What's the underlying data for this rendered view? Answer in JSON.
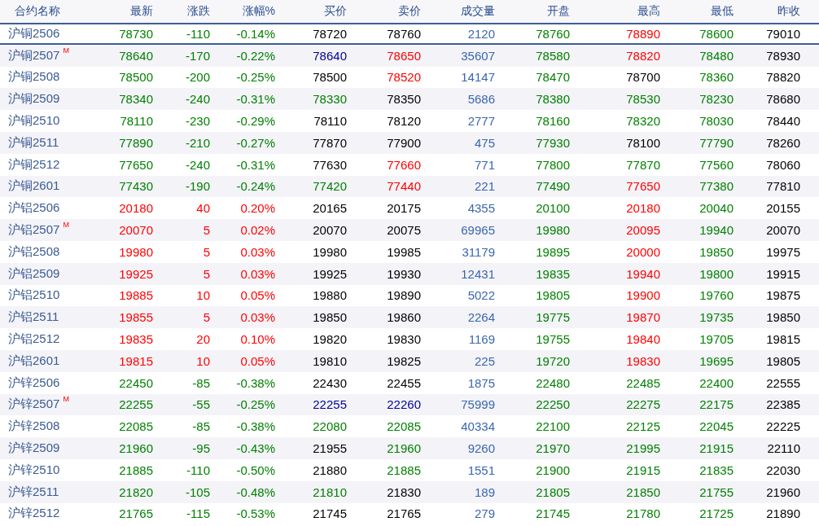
{
  "table": {
    "columns": [
      "合约名称",
      "最新",
      "涨跌",
      "涨幅%",
      "买价",
      "卖价",
      "成交量",
      "开盘",
      "最高",
      "最低",
      "昨收"
    ],
    "rows": [
      {
        "selected": true,
        "cells": [
          {
            "text": "沪铜2506"
          },
          {
            "text": "78730",
            "color": "#008000"
          },
          {
            "text": "-110",
            "color": "#008000"
          },
          {
            "text": "-0.14%",
            "color": "#008000"
          },
          {
            "text": "78720",
            "color": "#000000"
          },
          {
            "text": "78760",
            "color": "#000000"
          },
          {
            "text": "2120",
            "color": "#3a66b0"
          },
          {
            "text": "78760",
            "color": "#008000"
          },
          {
            "text": "78890",
            "color": "#ff0000"
          },
          {
            "text": "78600",
            "color": "#008000"
          },
          {
            "text": "79010",
            "color": "#000000"
          }
        ]
      },
      {
        "selected": false,
        "cells": [
          {
            "text": "沪铜2507",
            "badge": "M"
          },
          {
            "text": "78640",
            "color": "#008000"
          },
          {
            "text": "-170",
            "color": "#008000"
          },
          {
            "text": "-0.22%",
            "color": "#008000"
          },
          {
            "text": "78640",
            "color": "#000099"
          },
          {
            "text": "78650",
            "color": "#ff0000"
          },
          {
            "text": "35607",
            "color": "#3a66b0"
          },
          {
            "text": "78580",
            "color": "#008000"
          },
          {
            "text": "78820",
            "color": "#ff0000"
          },
          {
            "text": "78480",
            "color": "#008000"
          },
          {
            "text": "78930",
            "color": "#000000"
          }
        ]
      },
      {
        "selected": false,
        "cells": [
          {
            "text": "沪铜2508"
          },
          {
            "text": "78500",
            "color": "#008000"
          },
          {
            "text": "-200",
            "color": "#008000"
          },
          {
            "text": "-0.25%",
            "color": "#008000"
          },
          {
            "text": "78500",
            "color": "#000000"
          },
          {
            "text": "78520",
            "color": "#ff0000"
          },
          {
            "text": "14147",
            "color": "#3a66b0"
          },
          {
            "text": "78470",
            "color": "#008000"
          },
          {
            "text": "78700",
            "color": "#000000"
          },
          {
            "text": "78360",
            "color": "#008000"
          },
          {
            "text": "78820",
            "color": "#000000"
          }
        ]
      },
      {
        "selected": false,
        "cells": [
          {
            "text": "沪铜2509"
          },
          {
            "text": "78340",
            "color": "#008000"
          },
          {
            "text": "-240",
            "color": "#008000"
          },
          {
            "text": "-0.31%",
            "color": "#008000"
          },
          {
            "text": "78330",
            "color": "#008000"
          },
          {
            "text": "78350",
            "color": "#000000"
          },
          {
            "text": "5686",
            "color": "#3a66b0"
          },
          {
            "text": "78380",
            "color": "#008000"
          },
          {
            "text": "78530",
            "color": "#008000"
          },
          {
            "text": "78230",
            "color": "#008000"
          },
          {
            "text": "78680",
            "color": "#000000"
          }
        ]
      },
      {
        "selected": false,
        "cells": [
          {
            "text": "沪铜2510"
          },
          {
            "text": "78110",
            "color": "#008000"
          },
          {
            "text": "-230",
            "color": "#008000"
          },
          {
            "text": "-0.29%",
            "color": "#008000"
          },
          {
            "text": "78110",
            "color": "#000000"
          },
          {
            "text": "78120",
            "color": "#000000"
          },
          {
            "text": "2777",
            "color": "#3a66b0"
          },
          {
            "text": "78160",
            "color": "#008000"
          },
          {
            "text": "78320",
            "color": "#008000"
          },
          {
            "text": "78030",
            "color": "#008000"
          },
          {
            "text": "78440",
            "color": "#000000"
          }
        ]
      },
      {
        "selected": false,
        "cells": [
          {
            "text": "沪铜2511"
          },
          {
            "text": "77890",
            "color": "#008000"
          },
          {
            "text": "-210",
            "color": "#008000"
          },
          {
            "text": "-0.27%",
            "color": "#008000"
          },
          {
            "text": "77870",
            "color": "#000000"
          },
          {
            "text": "77900",
            "color": "#000000"
          },
          {
            "text": "475",
            "color": "#3a66b0"
          },
          {
            "text": "77930",
            "color": "#008000"
          },
          {
            "text": "78100",
            "color": "#000000"
          },
          {
            "text": "77790",
            "color": "#008000"
          },
          {
            "text": "78260",
            "color": "#000000"
          }
        ]
      },
      {
        "selected": false,
        "cells": [
          {
            "text": "沪铜2512"
          },
          {
            "text": "77650",
            "color": "#008000"
          },
          {
            "text": "-240",
            "color": "#008000"
          },
          {
            "text": "-0.31%",
            "color": "#008000"
          },
          {
            "text": "77630",
            "color": "#000000"
          },
          {
            "text": "77660",
            "color": "#ff0000"
          },
          {
            "text": "771",
            "color": "#3a66b0"
          },
          {
            "text": "77800",
            "color": "#008000"
          },
          {
            "text": "77870",
            "color": "#008000"
          },
          {
            "text": "77560",
            "color": "#008000"
          },
          {
            "text": "78060",
            "color": "#000000"
          }
        ]
      },
      {
        "selected": false,
        "cells": [
          {
            "text": "沪铜2601"
          },
          {
            "text": "77430",
            "color": "#008000"
          },
          {
            "text": "-190",
            "color": "#008000"
          },
          {
            "text": "-0.24%",
            "color": "#008000"
          },
          {
            "text": "77420",
            "color": "#008000"
          },
          {
            "text": "77440",
            "color": "#ff0000"
          },
          {
            "text": "221",
            "color": "#3a66b0"
          },
          {
            "text": "77490",
            "color": "#008000"
          },
          {
            "text": "77650",
            "color": "#ff0000"
          },
          {
            "text": "77380",
            "color": "#008000"
          },
          {
            "text": "77810",
            "color": "#000000"
          }
        ]
      },
      {
        "selected": false,
        "cells": [
          {
            "text": "沪铝2506"
          },
          {
            "text": "20180",
            "color": "#ff0000"
          },
          {
            "text": "40",
            "color": "#ff0000"
          },
          {
            "text": "0.20%",
            "color": "#ff0000"
          },
          {
            "text": "20165",
            "color": "#000000"
          },
          {
            "text": "20175",
            "color": "#000000"
          },
          {
            "text": "4355",
            "color": "#3a66b0"
          },
          {
            "text": "20100",
            "color": "#008000"
          },
          {
            "text": "20180",
            "color": "#ff0000"
          },
          {
            "text": "20040",
            "color": "#008000"
          },
          {
            "text": "20155",
            "color": "#000000"
          }
        ]
      },
      {
        "selected": false,
        "cells": [
          {
            "text": "沪铝2507",
            "badge": "M"
          },
          {
            "text": "20070",
            "color": "#ff0000"
          },
          {
            "text": "5",
            "color": "#ff0000"
          },
          {
            "text": "0.02%",
            "color": "#ff0000"
          },
          {
            "text": "20070",
            "color": "#000000"
          },
          {
            "text": "20075",
            "color": "#000000"
          },
          {
            "text": "69965",
            "color": "#3a66b0"
          },
          {
            "text": "19980",
            "color": "#008000"
          },
          {
            "text": "20095",
            "color": "#ff0000"
          },
          {
            "text": "19940",
            "color": "#008000"
          },
          {
            "text": "20070",
            "color": "#000000"
          }
        ]
      },
      {
        "selected": false,
        "cells": [
          {
            "text": "沪铝2508"
          },
          {
            "text": "19980",
            "color": "#ff0000"
          },
          {
            "text": "5",
            "color": "#ff0000"
          },
          {
            "text": "0.03%",
            "color": "#ff0000"
          },
          {
            "text": "19980",
            "color": "#000000"
          },
          {
            "text": "19985",
            "color": "#000000"
          },
          {
            "text": "31179",
            "color": "#3a66b0"
          },
          {
            "text": "19895",
            "color": "#008000"
          },
          {
            "text": "20000",
            "color": "#ff0000"
          },
          {
            "text": "19850",
            "color": "#008000"
          },
          {
            "text": "19975",
            "color": "#000000"
          }
        ]
      },
      {
        "selected": false,
        "cells": [
          {
            "text": "沪铝2509"
          },
          {
            "text": "19925",
            "color": "#ff0000"
          },
          {
            "text": "5",
            "color": "#ff0000"
          },
          {
            "text": "0.03%",
            "color": "#ff0000"
          },
          {
            "text": "19925",
            "color": "#000000"
          },
          {
            "text": "19930",
            "color": "#000000"
          },
          {
            "text": "12431",
            "color": "#3a66b0"
          },
          {
            "text": "19835",
            "color": "#008000"
          },
          {
            "text": "19940",
            "color": "#ff0000"
          },
          {
            "text": "19800",
            "color": "#008000"
          },
          {
            "text": "19915",
            "color": "#000000"
          }
        ]
      },
      {
        "selected": false,
        "cells": [
          {
            "text": "沪铝2510"
          },
          {
            "text": "19885",
            "color": "#ff0000"
          },
          {
            "text": "10",
            "color": "#ff0000"
          },
          {
            "text": "0.05%",
            "color": "#ff0000"
          },
          {
            "text": "19880",
            "color": "#000000"
          },
          {
            "text": "19890",
            "color": "#000000"
          },
          {
            "text": "5022",
            "color": "#3a66b0"
          },
          {
            "text": "19805",
            "color": "#008000"
          },
          {
            "text": "19900",
            "color": "#ff0000"
          },
          {
            "text": "19760",
            "color": "#008000"
          },
          {
            "text": "19875",
            "color": "#000000"
          }
        ]
      },
      {
        "selected": false,
        "cells": [
          {
            "text": "沪铝2511"
          },
          {
            "text": "19855",
            "color": "#ff0000"
          },
          {
            "text": "5",
            "color": "#ff0000"
          },
          {
            "text": "0.03%",
            "color": "#ff0000"
          },
          {
            "text": "19850",
            "color": "#000000"
          },
          {
            "text": "19860",
            "color": "#000000"
          },
          {
            "text": "2264",
            "color": "#3a66b0"
          },
          {
            "text": "19775",
            "color": "#008000"
          },
          {
            "text": "19870",
            "color": "#ff0000"
          },
          {
            "text": "19735",
            "color": "#008000"
          },
          {
            "text": "19850",
            "color": "#000000"
          }
        ]
      },
      {
        "selected": false,
        "cells": [
          {
            "text": "沪铝2512"
          },
          {
            "text": "19835",
            "color": "#ff0000"
          },
          {
            "text": "20",
            "color": "#ff0000"
          },
          {
            "text": "0.10%",
            "color": "#ff0000"
          },
          {
            "text": "19820",
            "color": "#000000"
          },
          {
            "text": "19830",
            "color": "#000000"
          },
          {
            "text": "1169",
            "color": "#3a66b0"
          },
          {
            "text": "19755",
            "color": "#008000"
          },
          {
            "text": "19840",
            "color": "#ff0000"
          },
          {
            "text": "19705",
            "color": "#008000"
          },
          {
            "text": "19815",
            "color": "#000000"
          }
        ]
      },
      {
        "selected": false,
        "cells": [
          {
            "text": "沪铝2601"
          },
          {
            "text": "19815",
            "color": "#ff0000"
          },
          {
            "text": "10",
            "color": "#ff0000"
          },
          {
            "text": "0.05%",
            "color": "#ff0000"
          },
          {
            "text": "19810",
            "color": "#000000"
          },
          {
            "text": "19825",
            "color": "#000000"
          },
          {
            "text": "225",
            "color": "#3a66b0"
          },
          {
            "text": "19720",
            "color": "#008000"
          },
          {
            "text": "19830",
            "color": "#ff0000"
          },
          {
            "text": "19695",
            "color": "#008000"
          },
          {
            "text": "19805",
            "color": "#000000"
          }
        ]
      },
      {
        "selected": false,
        "cells": [
          {
            "text": "沪锌2506"
          },
          {
            "text": "22450",
            "color": "#008000"
          },
          {
            "text": "-85",
            "color": "#008000"
          },
          {
            "text": "-0.38%",
            "color": "#008000"
          },
          {
            "text": "22430",
            "color": "#000000"
          },
          {
            "text": "22455",
            "color": "#000000"
          },
          {
            "text": "1875",
            "color": "#3a66b0"
          },
          {
            "text": "22480",
            "color": "#008000"
          },
          {
            "text": "22485",
            "color": "#008000"
          },
          {
            "text": "22400",
            "color": "#008000"
          },
          {
            "text": "22555",
            "color": "#000000"
          }
        ]
      },
      {
        "selected": false,
        "cells": [
          {
            "text": "沪锌2507",
            "badge": "M"
          },
          {
            "text": "22255",
            "color": "#008000"
          },
          {
            "text": "-55",
            "color": "#008000"
          },
          {
            "text": "-0.25%",
            "color": "#008000"
          },
          {
            "text": "22255",
            "color": "#000099"
          },
          {
            "text": "22260",
            "color": "#000099"
          },
          {
            "text": "75999",
            "color": "#3a66b0"
          },
          {
            "text": "22250",
            "color": "#008000"
          },
          {
            "text": "22275",
            "color": "#008000"
          },
          {
            "text": "22175",
            "color": "#008000"
          },
          {
            "text": "22385",
            "color": "#000000"
          }
        ]
      },
      {
        "selected": false,
        "cells": [
          {
            "text": "沪锌2508"
          },
          {
            "text": "22085",
            "color": "#008000"
          },
          {
            "text": "-85",
            "color": "#008000"
          },
          {
            "text": "-0.38%",
            "color": "#008000"
          },
          {
            "text": "22080",
            "color": "#008000"
          },
          {
            "text": "22085",
            "color": "#008000"
          },
          {
            "text": "40334",
            "color": "#3a66b0"
          },
          {
            "text": "22100",
            "color": "#008000"
          },
          {
            "text": "22125",
            "color": "#008000"
          },
          {
            "text": "22045",
            "color": "#008000"
          },
          {
            "text": "22225",
            "color": "#000000"
          }
        ]
      },
      {
        "selected": false,
        "cells": [
          {
            "text": "沪锌2509"
          },
          {
            "text": "21960",
            "color": "#008000"
          },
          {
            "text": "-95",
            "color": "#008000"
          },
          {
            "text": "-0.43%",
            "color": "#008000"
          },
          {
            "text": "21955",
            "color": "#000000"
          },
          {
            "text": "21960",
            "color": "#008000"
          },
          {
            "text": "9260",
            "color": "#3a66b0"
          },
          {
            "text": "21970",
            "color": "#008000"
          },
          {
            "text": "21995",
            "color": "#008000"
          },
          {
            "text": "21915",
            "color": "#008000"
          },
          {
            "text": "22110",
            "color": "#000000"
          }
        ]
      },
      {
        "selected": false,
        "cells": [
          {
            "text": "沪锌2510"
          },
          {
            "text": "21885",
            "color": "#008000"
          },
          {
            "text": "-110",
            "color": "#008000"
          },
          {
            "text": "-0.50%",
            "color": "#008000"
          },
          {
            "text": "21880",
            "color": "#000000"
          },
          {
            "text": "21885",
            "color": "#008000"
          },
          {
            "text": "1551",
            "color": "#3a66b0"
          },
          {
            "text": "21900",
            "color": "#008000"
          },
          {
            "text": "21915",
            "color": "#008000"
          },
          {
            "text": "21835",
            "color": "#008000"
          },
          {
            "text": "22030",
            "color": "#000000"
          }
        ]
      },
      {
        "selected": false,
        "cells": [
          {
            "text": "沪锌2511"
          },
          {
            "text": "21820",
            "color": "#008000"
          },
          {
            "text": "-105",
            "color": "#008000"
          },
          {
            "text": "-0.48%",
            "color": "#008000"
          },
          {
            "text": "21810",
            "color": "#008000"
          },
          {
            "text": "21830",
            "color": "#000000"
          },
          {
            "text": "189",
            "color": "#3a66b0"
          },
          {
            "text": "21805",
            "color": "#008000"
          },
          {
            "text": "21850",
            "color": "#008000"
          },
          {
            "text": "21755",
            "color": "#008000"
          },
          {
            "text": "21960",
            "color": "#000000"
          }
        ]
      },
      {
        "selected": false,
        "cells": [
          {
            "text": "沪锌2512"
          },
          {
            "text": "21765",
            "color": "#008000"
          },
          {
            "text": "-115",
            "color": "#008000"
          },
          {
            "text": "-0.53%",
            "color": "#008000"
          },
          {
            "text": "21745",
            "color": "#000000"
          },
          {
            "text": "21765",
            "color": "#000000"
          },
          {
            "text": "279",
            "color": "#3a66b0"
          },
          {
            "text": "21745",
            "color": "#008000"
          },
          {
            "text": "21780",
            "color": "#008000"
          },
          {
            "text": "21725",
            "color": "#008000"
          },
          {
            "text": "21890",
            "color": "#000000"
          }
        ]
      }
    ]
  }
}
